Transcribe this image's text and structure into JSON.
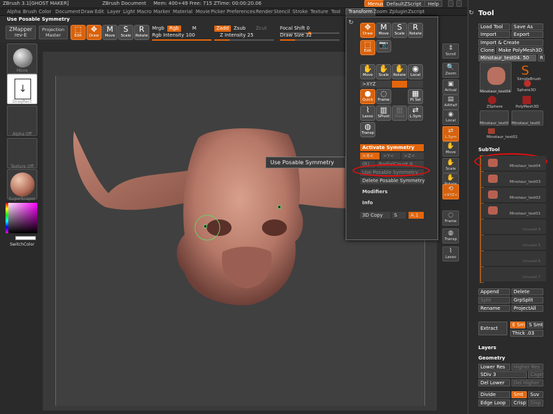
{
  "titlebar": {
    "app": "ZBrush 3.1[GHOST MAKER]",
    "document": "ZBrush Document",
    "stats": "Mem: 400+49  Free: 715  ZTime: 00:00:20.06",
    "menus_btn": "Menus",
    "default_script": "DefaultZScript",
    "help_btn": "Help"
  },
  "menubar": {
    "items": [
      "Alpha",
      "Brush",
      "Color",
      "Document",
      "Draw",
      "Edit",
      "Layer",
      "Light",
      "Macro",
      "Marker",
      "Material",
      "Movie",
      "Picker",
      "Preferences",
      "Render",
      "Stencil",
      "Stroke",
      "Texture",
      "Tool",
      "Transform",
      "Zoom",
      "Zplugin",
      "Zscript"
    ],
    "active": "Transform"
  },
  "toolbar": {
    "heading": "Use Posable Symmetry",
    "zmapper": "ZMapper",
    "zmapper_sub": "rev-E",
    "projection": "Projection",
    "projection_sub": "Master",
    "edit": "Edit",
    "draw": "Draw",
    "move": "Move",
    "scale": "Scale",
    "rotate": "Rotate",
    "mrgb": "Mrgb",
    "rgb": "Rgb",
    "m": "M",
    "rgb_intensity_label": "Rgb Intensity",
    "rgb_intensity": "100",
    "rgb_intensity_level": 1.0,
    "zadd": "Zadd",
    "zsub": "Zsub",
    "zcut": "Zcut",
    "z_intensity_label": "Z Intensity",
    "z_intensity": "25",
    "z_intensity_level": 0.25,
    "focal_shift_label": "Focal Shift",
    "focal_shift": "0",
    "draw_size_label": "Draw Size",
    "draw_size": "32",
    "draw_size_level": 0.25
  },
  "leftshelf": {
    "move": "Move",
    "dragrect": "DragRect",
    "alpha": "Alpha Off",
    "texture": "Texture Off",
    "material": "SuperScaper",
    "switchcolor": "SwitchColor"
  },
  "transform_panel": {
    "btn_draw": "Draw",
    "btn_move": "Move",
    "btn_scale": "Scale",
    "btn_rotate": "Rotate",
    "btn_edit": "Edit",
    "row2": [
      "Move",
      "Scale",
      "Rotate",
      "Local"
    ],
    "xyz": ">XYZ<",
    "quick": "Quick",
    "frame": "Frame",
    "ptsel": "Pt Sel",
    "lasso": "Lasso",
    "sdiv": "SPivot",
    "ppivot": "Pivot",
    "lsym": "L.Sym",
    "transp": "Transp",
    "activate_symmetry": "Activate Symmetry",
    "sym_x": ">X<",
    "sym_y": ">Y<",
    "sym_z": ">Z<",
    "radial_r": "(R)",
    "radial_count": "RadialCount 8",
    "use_posable": "Use Posable Symmetry",
    "delete_posable": "Delete Posable Symmetry",
    "modifiers": "Modifiers",
    "info": "Info",
    "copy3d": "3D Copy",
    "copy_s": "S",
    "copy_a": "A.1"
  },
  "tooltip": "Use Posable Symmetry",
  "rightshelf": [
    "Scroll",
    "Zoom",
    "Actual",
    "AAHalf",
    "Local",
    "L.Sym",
    "Move",
    "Scale",
    "Rotate",
    ">XYZ<",
    "Frame",
    "Transp",
    "Lasso"
  ],
  "toolpanel": {
    "title": "Tool",
    "load_tool": "Load Tool",
    "save_as": "Save As",
    "import": "Import",
    "export": "Export",
    "import_create": "Import & Create",
    "clone": "Clone",
    "make_polymesh": "Make PolyMesh3D",
    "current_tool": "Minotaur_test04. 50",
    "r": "R",
    "tiles": [
      "Minotaur_test04",
      "SimpleBrush",
      "Sphere3D",
      "ZSphere",
      "PolyMesh3D",
      "Minotaur_test0",
      "Minotaur_test0",
      "Minotaur_test01"
    ],
    "subtool_header": "SubTool",
    "subtools": [
      "Minotaur_test04",
      "Minotaur_test03",
      "Minotaur_test02",
      "Minotaur_test01",
      "Unused 4",
      "Unused 5",
      "Unused 6",
      "Unused 7"
    ],
    "append": "Append",
    "delete": "Delete",
    "split": "Split",
    "grpsplit": "GrpSplit",
    "rename": "Rename",
    "projectall": "ProjectAll",
    "extract": "Extract",
    "e_smt": "E Smt",
    "s_smt": "S Smt",
    "thick": "Thick .03",
    "layers": "Layers",
    "geometry": "Geometry",
    "lower_res": "Lower Res",
    "higher_res": "Higher Res",
    "sdiv": "SDiv 3",
    "cage": "Cage",
    "del_lower": "Del Lower",
    "del_higher": "Del Higher",
    "divide": "Divide",
    "smt": "Smt",
    "suv": "Suv",
    "edge_loop": "Edge Loop",
    "crisp": "Crisp",
    "disp": "Disp"
  },
  "colors": {
    "accent": "#e3660c",
    "highlight_ring": "#e01010"
  }
}
